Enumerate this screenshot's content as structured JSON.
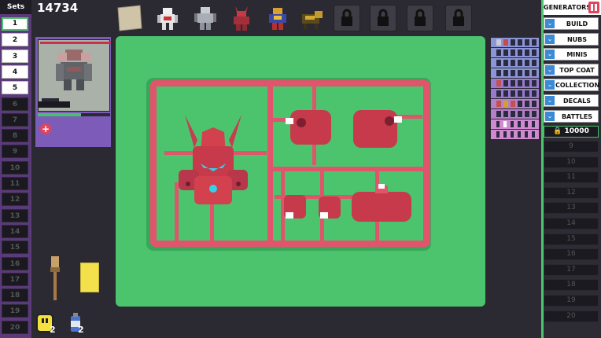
{
  "sets": {
    "header": "Sets",
    "items": [
      "1",
      "2",
      "3",
      "4",
      "5",
      "6",
      "7",
      "8",
      "9",
      "10",
      "11",
      "12",
      "13",
      "14",
      "15",
      "16",
      "17",
      "18",
      "19",
      "20"
    ],
    "unlocked_count": 5,
    "active_index": 0
  },
  "score": "14734",
  "top_row": {
    "slots": [
      "paper-scrap",
      "white-robot",
      "grey-robot",
      "red-robot",
      "gold-robot",
      "dog-robot",
      "lock",
      "lock",
      "lock",
      "lock"
    ]
  },
  "card": {
    "hp_fraction": 0.6
  },
  "generators": {
    "header": "GENERATORS",
    "buttons": [
      "BUILD",
      "NUBS",
      "MINIS",
      "TOP COAT",
      "COLLECTION",
      "DECALS",
      "BATTLES"
    ],
    "locked_cost": "10000",
    "slots": [
      "9",
      "10",
      "11",
      "12",
      "13",
      "14",
      "15",
      "16",
      "17",
      "18",
      "19",
      "20"
    ]
  },
  "tools": {
    "glue_count": "2",
    "spray_count": "2"
  },
  "colors": {
    "board": "#4cc46e",
    "sprue": "#e0556b",
    "parts": "#d3404e",
    "accent_cyan": "#35d0e6"
  }
}
